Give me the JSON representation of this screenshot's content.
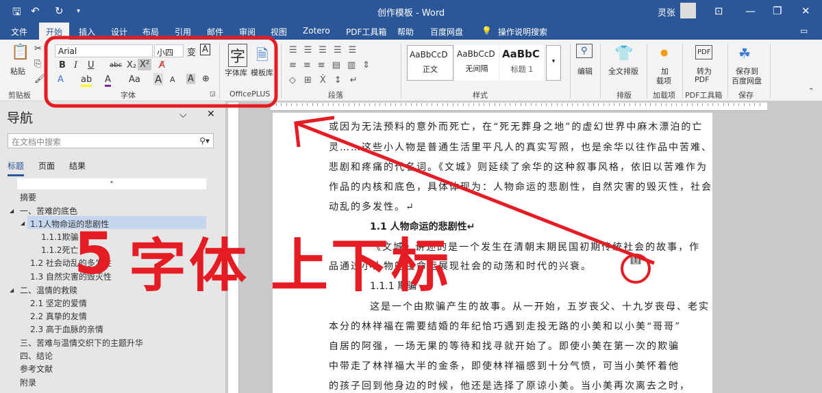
{
  "titlebar": {
    "title": "创作模板 - Word",
    "user": "灵张"
  },
  "tabs": [
    "文件",
    "开始",
    "插入",
    "设计",
    "布局",
    "引用",
    "邮件",
    "审阅",
    "视图",
    "Zotero",
    "PDF工具箱",
    "帮助",
    "百度网盘"
  ],
  "tell_me": "操作说明搜索",
  "ribbon": {
    "clipboard": {
      "paste": "粘贴",
      "label": "剪贴板"
    },
    "font": {
      "name": "Arial",
      "size": "小四",
      "label": "字体",
      "bold": "B",
      "italic": "I",
      "underline": "U",
      "strike": "abc",
      "subscript": "X₂",
      "superscript": "X²",
      "case": "Aa",
      "grow": "A",
      "shrink": "A"
    },
    "officeplus": {
      "font_lib": "字体库",
      "template_lib": "模板库",
      "label": "OfficePLUS"
    },
    "paragraph": {
      "label": "段落"
    },
    "styles": {
      "items": [
        {
          "preview": "AaBbCcD",
          "name": "正文"
        },
        {
          "preview": "AaBbCcD",
          "name": "无间隔"
        },
        {
          "preview": "AaBbC",
          "name": "标题 1"
        }
      ],
      "label": "样式"
    },
    "editing": {
      "label": "编辑"
    },
    "layout": {
      "btn": "全文排版",
      "label": "排版"
    },
    "addins": {
      "btn1": "加",
      "btn2": "载项",
      "label": "加载项"
    },
    "pdf": {
      "btn1": "转为",
      "btn2": "PDF",
      "label": "PDF工具箱"
    },
    "save": {
      "btn1": "保存到",
      "btn2": "百度网盘",
      "label": "保存"
    }
  },
  "nav": {
    "title": "导航",
    "search_placeholder": "在文档中搜索",
    "tabs": [
      "标题",
      "页面",
      "结果"
    ],
    "items": [
      "摘要",
      "一、苦难的底色",
      "1.1人物命运的悲剧性",
      "1.1.1欺骗",
      "1.1.2死亡",
      "1.2 社会动乱的多发性",
      "1.3 自然灾害的毁灭性",
      "二、温情的救赎",
      "2.1 坚定的爱情",
      "2.2 真挚的友情",
      "2.3 高于血脉的亲情",
      "三、苦难与温情交织下的主题升华",
      "四、结论",
      "参考文献",
      "附录"
    ]
  },
  "document": {
    "lines": [
      "或因为无法预料的意外而死亡，在“死无葬身之地”的虚幻世界中麻木漂泊的亡",
      "灵……这些小人物是普通生活里平凡人的真实写照，也是余华以往作品中苦难、",
      "悲剧和疼痛的代名词。《文城》则延续了余华的这种叙事风格，依旧以苦难作为",
      "作品的内核和底色，具体体现为：人物命运的悲剧性，自然灾害的毁灭性，社会",
      "动乱的多发性。↵"
    ],
    "heading1": "1.1 人物命运的悲剧性↵",
    "para2": [
      "“《文城》讲述的是一个发生在清朝末期民国初期传统社会的故事，作",
      "品通过小人物的生命运展现社会的动荡和时代的兴衰。"
    ],
    "footnote_ref": "[1]",
    "heading2": "1.1.1 欺骗",
    "para3": [
      "这是一个由欺骗产生的故事。从一开始，五岁丧父、十九岁丧母、老实",
      "本分的林祥福在需要结婚的年纪恰巧遇到走投无路的小美和以小美“哥哥”",
      "自居的阿强，一场无果的等待和找寻就开始了。即使小美在第一次的欺骗",
      "中带走了林祥福大半的金条，即使林祥福感到十分气愤，可当小美怀着他",
      "的孩子回到他身边的时候，他还是选择了原谅小美。当小美再次离去之时，"
    ]
  },
  "overlay": {
    "number": "5",
    "text1": "字体",
    "text2": "上下标"
  },
  "colors": {
    "word_blue": "#2b579a",
    "annotation_red": "#e51c24"
  }
}
